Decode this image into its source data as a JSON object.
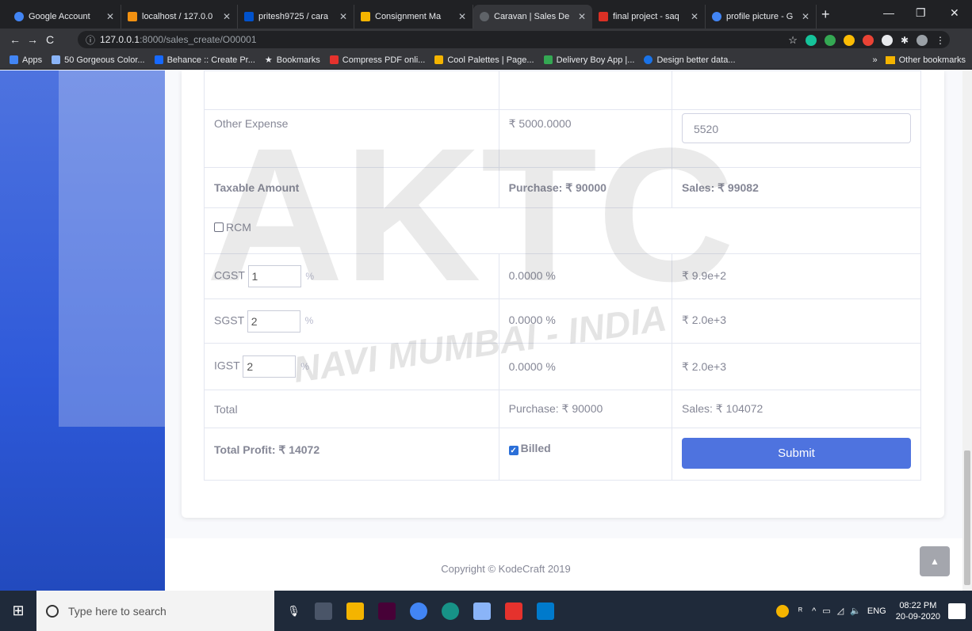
{
  "browser": {
    "tabs": [
      {
        "title": "Google Account",
        "color": "#4285f4"
      },
      {
        "title": "localhost / 127.0.0",
        "color": "#f29111"
      },
      {
        "title": "pritesh9725 / cara",
        "color": "#0052cc"
      },
      {
        "title": "Consignment Ma",
        "color": "#f4b400"
      },
      {
        "title": "Caravan | Sales De",
        "color": "#5f6368"
      },
      {
        "title": "final project - saq",
        "color": "#d93025"
      },
      {
        "title": "profile picture - G",
        "color": "#4285f4"
      }
    ],
    "url_host": "127.0.0.1",
    "url_path": ":8000/sales_create/O00001",
    "bookmarks": [
      {
        "label": "Apps",
        "color": "#4285f4"
      },
      {
        "label": "50 Gorgeous Color...",
        "color": "#8ab4f8"
      },
      {
        "label": "Behance :: Create Pr...",
        "color": "#1769ff"
      },
      {
        "label": "Bookmarks",
        "color": "#e8eaed"
      },
      {
        "label": "Compress PDF onli...",
        "color": "#e5322d"
      },
      {
        "label": "Cool Palettes | Page...",
        "color": "#f4b400"
      },
      {
        "label": "Delivery Boy App |...",
        "color": "#34a853"
      },
      {
        "label": "Design better data...",
        "color": "#1a73e8"
      }
    ],
    "other_bookmarks": "Other bookmarks",
    "overflow": "»"
  },
  "form": {
    "other_expense": {
      "label": "Other Expense",
      "purchase": "₹ 5000.0000",
      "sales_value": "5520"
    },
    "taxable": {
      "label": "Taxable Amount",
      "purchase": "Purchase: ₹ 90000",
      "sales": "Sales: ₹ 99082"
    },
    "rcm": {
      "label": "RCM"
    },
    "cgst": {
      "label": "CGST",
      "value": "1",
      "unit": "%",
      "rate": "0.0000 %",
      "amount": "₹ 9.9e+2"
    },
    "sgst": {
      "label": "SGST",
      "value": "2",
      "unit": "%",
      "rate": "0.0000 %",
      "amount": "₹ 2.0e+3"
    },
    "igst": {
      "label": "IGST",
      "value": "2",
      "unit": "%",
      "rate": "0.0000 %",
      "amount": "₹ 2.0e+3"
    },
    "total": {
      "label": "Total",
      "purchase": "Purchase: ₹ 90000",
      "sales": "Sales: ₹ 104072"
    },
    "profit": {
      "label": "Total Profit: ₹ 14072"
    },
    "billed": {
      "label": "Billed",
      "checked": true
    },
    "submit_label": "Submit"
  },
  "footer": {
    "copyright": "Copyright © KodeCraft 2019",
    "scroll_top_icon": "chevron-up-icon"
  },
  "watermark": {
    "letters": "AKTC",
    "motto": "NAVI MUMBAI - INDIA"
  },
  "taskbar": {
    "search_placeholder": "Type here to search",
    "lang": "ENG",
    "time": "08:22 PM",
    "date": "20-09-2020"
  }
}
